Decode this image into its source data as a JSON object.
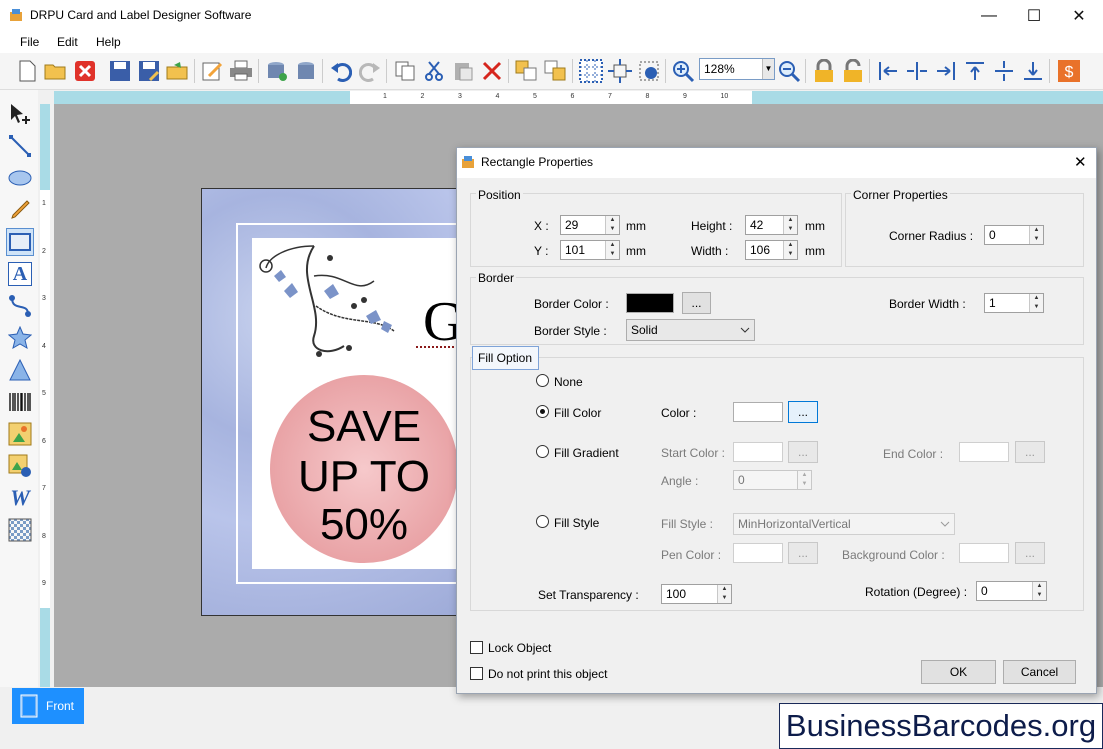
{
  "window": {
    "title": "DRPU Card and Label Designer Software",
    "minimize_glyph": "—",
    "maximize_glyph": "☐",
    "close_glyph": "✕"
  },
  "menu": {
    "items": [
      "File",
      "Edit",
      "Help"
    ]
  },
  "toolbar": {
    "zoom_value": "128%",
    "zoom_arrow": "▼",
    "icons": [
      "new-icon",
      "open-icon",
      "close-file-icon",
      "save-icon",
      "save-as-icon",
      "export-icon",
      "edit-icon",
      "print-icon",
      "database-add-icon",
      "database-icon",
      "undo-icon",
      "redo-icon",
      "copy-icon",
      "cut-icon",
      "paste-icon",
      "delete-icon",
      "send-back-icon",
      "bring-front-icon",
      "grid-icon",
      "center-icon",
      "settings-icon",
      "zoom-in-icon",
      "zoom-out-icon",
      "lock-icon",
      "unlock-icon",
      "align-left-icon",
      "align-center-h-icon",
      "align-right-icon",
      "align-top-icon",
      "align-middle-icon",
      "align-bottom-icon",
      "price-icon"
    ]
  },
  "toolbox": {
    "icons": [
      "select-icon",
      "line-icon",
      "ellipse-icon",
      "pencil-icon",
      "rectangle-icon",
      "text-icon",
      "curve-icon",
      "star-icon",
      "triangle-icon",
      "barcode-icon",
      "image-icon",
      "picture-library-icon",
      "word-art-icon",
      "pattern-icon"
    ],
    "text_tool_glyph": "A",
    "word_art_glyph": "W"
  },
  "ruler": {
    "h_labels": [
      "1",
      "2",
      "3",
      "4",
      "5",
      "6",
      "7",
      "8",
      "9",
      "10"
    ],
    "v_labels": [
      "1",
      "2",
      "3",
      "4",
      "5",
      "6",
      "7",
      "8",
      "9"
    ]
  },
  "card": {
    "save_line1": "SAVE",
    "save_line2": "UP TO",
    "save_line3": "50%",
    "big_letter": "G"
  },
  "bottom": {
    "front_tab": "Front",
    "watermark": "BusinessBarcodes.org"
  },
  "dialog": {
    "title": "Rectangle Properties",
    "close_glyph": "✕",
    "position": {
      "group_label": "Position",
      "x_label": "X :",
      "x_value": "29",
      "y_label": "Y :",
      "y_value": "101",
      "height_label": "Height :",
      "height_value": "42",
      "width_label": "Width :",
      "width_value": "106",
      "unit": "mm"
    },
    "corner": {
      "group_label": "Corner Properties",
      "radius_label": "Corner Radius :",
      "radius_value": "0"
    },
    "border": {
      "group_label": "Border",
      "color_label": "Border Color :",
      "color_value": "#000000",
      "browse_label": "...",
      "style_label": "Border Style :",
      "style_value": "Solid",
      "width_label": "Border Width :",
      "width_value": "1"
    },
    "fill": {
      "group_label": "Fill Option",
      "none_label": "None",
      "fill_color_label": "Fill Color",
      "color_label": "Color :",
      "browse_label": "...",
      "fill_gradient_label": "Fill Gradient",
      "start_color_label": "Start Color :",
      "end_color_label": "End Color :",
      "angle_label": "Angle :",
      "angle_value": "0",
      "fill_style_label": "Fill Style",
      "fill_style_field_label": "Fill Style :",
      "fill_style_value": "MinHorizontalVertical",
      "pen_color_label": "Pen Color :",
      "background_color_label": "Background Color :",
      "transparency_label": "Set Transparency :",
      "transparency_value": "100",
      "rotation_label": "Rotation (Degree) :",
      "rotation_value": "0",
      "selected": "Fill Color"
    },
    "lock_label": "Lock Object",
    "noprint_label": "Do not print this object",
    "ok_label": "OK",
    "cancel_label": "Cancel"
  }
}
